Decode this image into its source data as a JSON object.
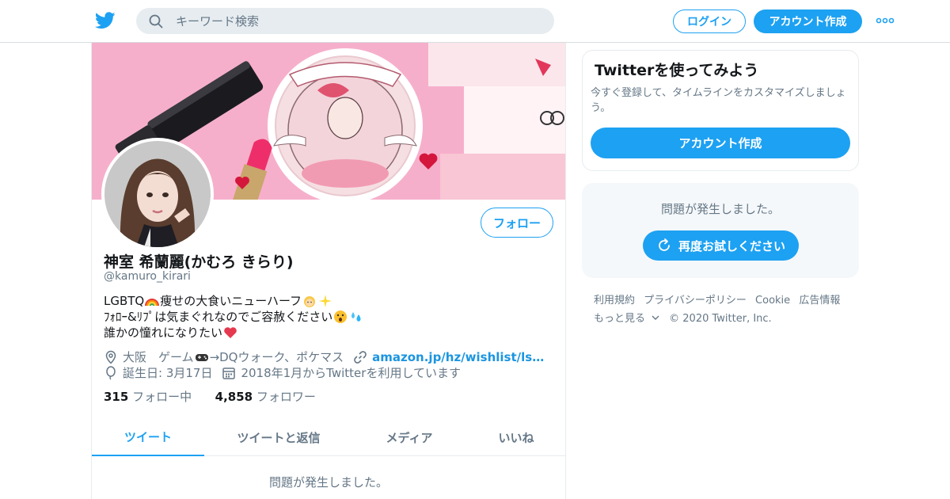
{
  "header": {
    "search_placeholder": "キーワード検索",
    "login_label": "ログイン",
    "signup_label": "アカウント作成"
  },
  "profile": {
    "follow_label": "フォロー",
    "name": "神室 希蘭麗(かむろ きらり)",
    "handle": "@kamuro_kirari",
    "bio_line1_a": "LGBTQ",
    "bio_line1_b": " 痩せの大食いニューハーフ",
    "bio_line2": "ﾌｫﾛｰ&ﾘﾌﾟは気まぐれなのでご容赦ください",
    "bio_line3": "誰かの憧れになりたい",
    "location": "大阪　ゲーム",
    "location_suffix": "→DQウォーク、ポケマス",
    "website": "amazon.jp/hz/wishlist/ls…",
    "birthday": "誕生日: 3月17日",
    "joined": "2018年1月からTwitterを利用しています",
    "following_count": "315",
    "following_label": "フォロー中",
    "followers_count": "4,858",
    "followers_label": "フォロワー"
  },
  "tabs": [
    {
      "label": "ツイート",
      "active": true
    },
    {
      "label": "ツイートと返信",
      "active": false
    },
    {
      "label": "メディア",
      "active": false
    },
    {
      "label": "いいね",
      "active": false
    }
  ],
  "main_error": "問題が発生しました。",
  "sidebar": {
    "signup_card": {
      "title": "Twitterを使ってみよう",
      "description": "今すぐ登録して、タイムラインをカスタマイズしましょう。",
      "button": "アカウント作成"
    },
    "error_card": {
      "message": "問題が発生しました。",
      "retry": "再度お試しください"
    },
    "footer": {
      "links": [
        "利用規約",
        "プライバシーポリシー",
        "Cookie",
        "広告情報"
      ],
      "more": "もっと見る",
      "copyright": "© 2020 Twitter, Inc."
    }
  },
  "colors": {
    "accent": "#1da1f2",
    "text_secondary": "#657786",
    "banner_pink": "#f4a9c6"
  }
}
